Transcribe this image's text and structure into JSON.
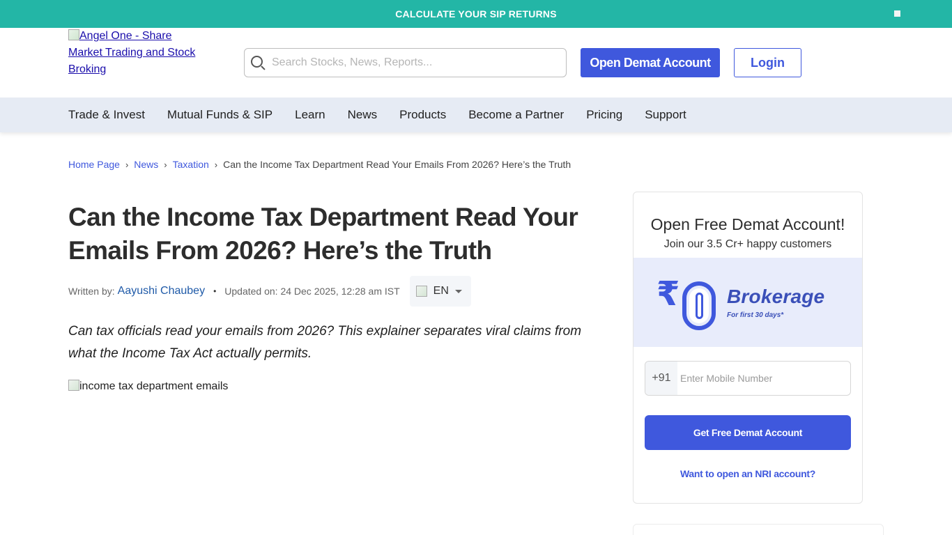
{
  "topbar": {
    "link_label": "CALCULATE YOUR SIP RETURNS",
    "close_icon": "close-icon",
    "background": "#23b6a6"
  },
  "header": {
    "logo_alt": "Angel One - Share Market Trading and Stock Broking",
    "search_placeholder": "Search Stocks, News, Reports...",
    "open_demat_label": "Open Demat Account",
    "login_label": "Login",
    "accent": "#3f58dd"
  },
  "nav": {
    "items": [
      "Trade & Invest",
      "Mutual Funds & SIP",
      "Learn",
      "News",
      "Products",
      "Become a Partner",
      "Pricing",
      "Support"
    ],
    "background": "#e6ebf4"
  },
  "breadcrumb": {
    "items": [
      "Home Page",
      "News",
      "Taxation"
    ],
    "current": "Can the Income Tax Department Read Your Emails From 2026? Here’s the Truth"
  },
  "article": {
    "title": "Can the Income Tax Department Read Your Emails From 2026? Here’s the Truth",
    "written_by_label": "Written by:",
    "author": "Aayushi Chaubey",
    "updated": "Updated on: 24 Dec 2025, 12:28 am IST",
    "language": "EN",
    "summary": "Can tax officials read your emails from 2026? This explainer separates viral claims from what the Income Tax Act actually permits.",
    "image_alt": "income tax department emails"
  },
  "signup_card": {
    "title": "Open Free Demat Account!",
    "subtitle": "Join our 3.5 Cr+ happy customers",
    "banner_rupee": "₹",
    "banner_heading": "Brokerage",
    "banner_sub": "For first 30 days*",
    "phone_prefix": "+91",
    "phone_placeholder": "Enter Mobile Number",
    "submit_label": "Get Free Demat Account",
    "nri_link": "Want to open an NRI account?"
  }
}
